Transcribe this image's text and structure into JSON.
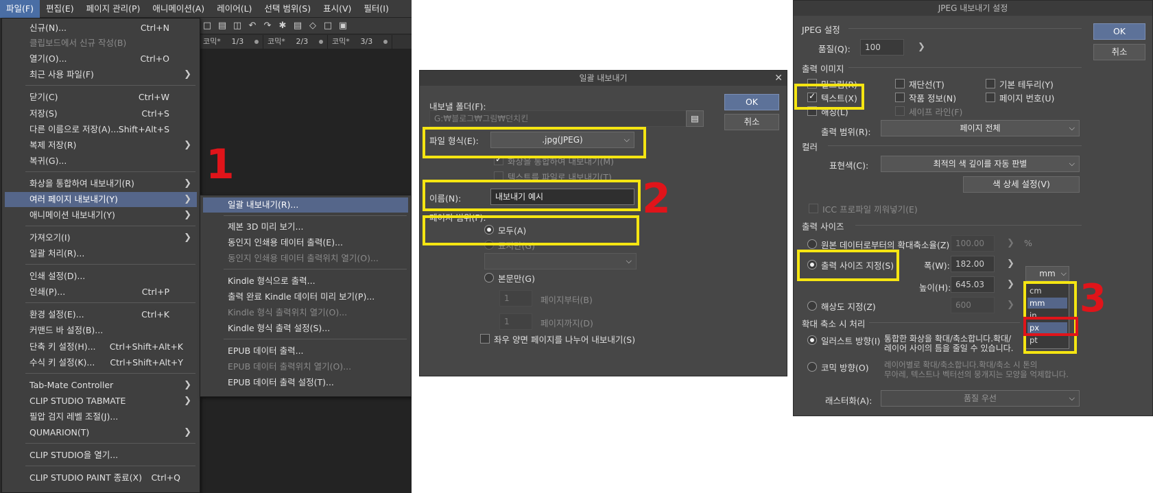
{
  "menubar": [
    "파일(F)",
    "편집(E)",
    "페이지 관리(P)",
    "애니메이션(A)",
    "레이어(L)",
    "선택 범위(S)",
    "표시(V)",
    "필터(I)"
  ],
  "tabs": [
    {
      "name": "코믹*",
      "page": "1/3"
    },
    {
      "name": "코믹*",
      "page": "2/3"
    },
    {
      "name": "코믹*",
      "page": "3/3"
    }
  ],
  "file_menu": [
    {
      "label": "신규(N)...",
      "shortcut": "Ctrl+N"
    },
    {
      "label": "클립보드에서 신규 작성(B)",
      "disabled": true
    },
    {
      "label": "열기(O)...",
      "shortcut": "Ctrl+O"
    },
    {
      "label": "최근 사용 파일(F)",
      "submenu": true
    },
    {
      "label": "닫기(C)",
      "shortcut": "Ctrl+W"
    },
    {
      "label": "저장(S)",
      "shortcut": "Ctrl+S"
    },
    {
      "label": "다른 이름으로 저장(A)...",
      "shortcut": "Shift+Alt+S"
    },
    {
      "label": "복제 저장(R)",
      "submenu": true
    },
    {
      "label": "복귀(G)..."
    },
    {
      "label": "화상을 통합하여 내보내기(R)",
      "submenu": true
    },
    {
      "label": "여러 페이지 내보내기(Y)",
      "submenu": true,
      "highlighted": true
    },
    {
      "label": "애니메이션 내보내기(Y)",
      "submenu": true
    },
    {
      "label": "가져오기(I)",
      "submenu": true
    },
    {
      "label": "일괄 처리(R)..."
    },
    {
      "label": "인쇄 설정(D)..."
    },
    {
      "label": "인쇄(P)...",
      "shortcut": "Ctrl+P"
    },
    {
      "label": "환경 설정(E)...",
      "shortcut": "Ctrl+K"
    },
    {
      "label": "커맨드 바 설정(B)..."
    },
    {
      "label": "단축 키 설정(H)...",
      "shortcut": "Ctrl+Shift+Alt+K"
    },
    {
      "label": "수식 키 설정(K)...",
      "shortcut": "Ctrl+Shift+Alt+Y"
    },
    {
      "label": "Tab-Mate Controller",
      "submenu": true
    },
    {
      "label": "CLIP STUDIO TABMATE",
      "submenu": true
    },
    {
      "label": "필압 검지 레벨 조절(J)..."
    },
    {
      "label": "QUMARION(T)",
      "submenu": true
    },
    {
      "label": "CLIP STUDIO을 열기..."
    },
    {
      "label": "CLIP STUDIO PAINT 종료(X)",
      "shortcut": "Ctrl+Q"
    }
  ],
  "sub_menu": [
    {
      "label": "일괄 내보내기(R)...",
      "highlighted": true
    },
    {
      "label": "제본 3D 미리 보기..."
    },
    {
      "label": "동인지 인쇄용 데이터 출력(E)..."
    },
    {
      "label": "동인지 인쇄용 데이터 출력위치 열기(O)...",
      "disabled": true
    },
    {
      "label": "Kindle 형식으로 출력..."
    },
    {
      "label": "출력 완료 Kindle 데이터 미리 보기(P)..."
    },
    {
      "label": "Kindle 형식 출력위치 열기(O)...",
      "disabled": true
    },
    {
      "label": "Kindle 형식 출력 설정(S)..."
    },
    {
      "label": "EPUB 데이터 출력..."
    },
    {
      "label": "EPUB 데이터 출력위치 열기(O)...",
      "disabled": true
    },
    {
      "label": "EPUB 데이터 출력 설정(T)..."
    }
  ],
  "annotations": {
    "step1": "1",
    "step2": "2",
    "step3": "3"
  },
  "batch_dialog": {
    "title": "일괄 내보내기",
    "ok": "OK",
    "cancel": "취소",
    "folder_label": "내보낼 폴더(F):",
    "folder_value": "G:₩블로그₩그림₩던치킨",
    "format_label": "파일 형식(E):",
    "format_value": ".jpg(JPEG)",
    "merge_label": "화상을 통합하여 내보내기(M)",
    "text_label": "텍스트를 파일로 내보내기(T)",
    "name_label": "이름(N):",
    "name_value": "내보내기 예시",
    "range_label": "페이지 범위(F):",
    "all_label": "모두(A)",
    "cover_label": "표지만(G)",
    "body_label": "본문만(G)",
    "from_value": "1",
    "from_label": "페이지부터(B)",
    "to_value": "1",
    "to_label": "페이지까지(D)",
    "spread_label": "좌우 양면 페이지를 나누어 내보내기(S)"
  },
  "jpeg_dialog": {
    "title": "JPEG 내보내기 설정",
    "ok": "OK",
    "cancel": "취소",
    "jpeg_group": "JPEG 설정",
    "quality_label": "품질(Q):",
    "quality_value": "100",
    "output_image_group": "출력 이미지",
    "draft_label": "밑그림(R)",
    "trim_label": "재단선(T)",
    "border_label": "기본 테두리(Y)",
    "text_label": "텍스트(X)",
    "work_info_label": "작품 정보(N)",
    "page_no_label": "페이지 번호(U)",
    "hatch_label": "해칭(L)",
    "safe_label": "세이프 라인(F)",
    "output_range_label": "출력 범위(R):",
    "output_range_value": "페이지 전체",
    "color_group": "컬러",
    "color_label": "표현색(C):",
    "color_value": "최적의 색 깊이를 자동 판별",
    "color_detail": "색 상세 설정(V)",
    "icc_label": "ICC 프로파일 끼워넣기(E)",
    "size_group": "출력 사이즈",
    "scale_label": "원본 데이터로부터의 확대축소율(Z)",
    "scale_value": "100.00",
    "scale_unit": "%",
    "size_label": "출력 사이즈 지정(S)",
    "width_label": "폭(W):",
    "width_value": "182.00",
    "height_label": "높이(H):",
    "height_value": "645.03",
    "unit_value": "mm",
    "units": [
      "cm",
      "mm",
      "in",
      "px",
      "pt"
    ],
    "resolution_label": "해상도 지정(Z)",
    "resolution_value": "600",
    "scaling_group": "확대 축소 시 처리",
    "illust_label": "일러스트 방향(I)",
    "illust_desc": "통합한 화상을 확대/축소합니다.확대/\n레이어 사이의 틈을 줄일 수 있습니다.",
    "comic_label": "코믹 방향(O)",
    "comic_desc": "레이어별로 확대/축소합니다.확대/축소 시 톤의\n무아레, 텍스트나 벡터선의 뭉개지는 모양을 억제합니다.",
    "raster_label": "래스터화(A):",
    "raster_value": "품질 우선"
  }
}
